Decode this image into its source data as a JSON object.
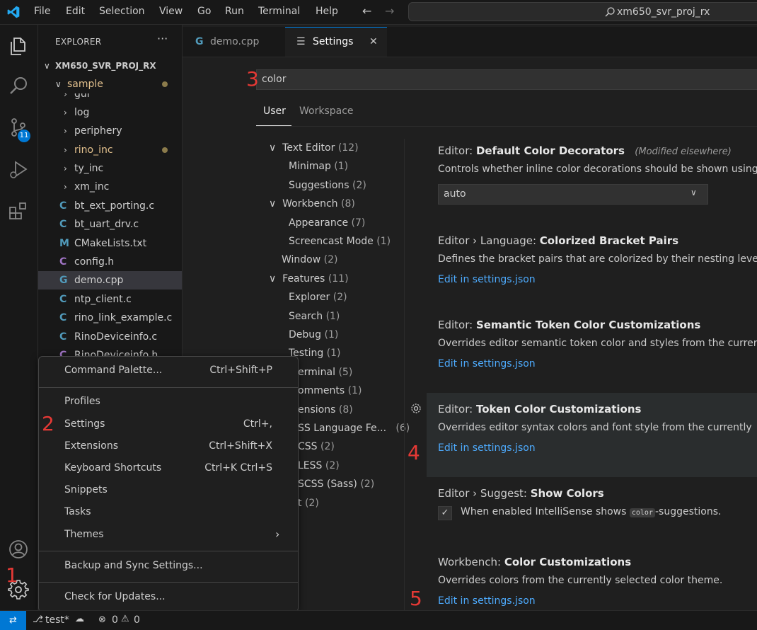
{
  "titlebar": {
    "menus": [
      "File",
      "Edit",
      "Selection",
      "View",
      "Go",
      "Run",
      "Terminal",
      "Help"
    ],
    "search_text": "xm650_svr_proj_rx"
  },
  "activity": {
    "source_control_badge": "11"
  },
  "explorer": {
    "header": "EXPLORER",
    "project": "XM650_SVR_PROJ_RX",
    "folder": "sample",
    "items": [
      {
        "label": "gui",
        "type": "folder"
      },
      {
        "label": "log",
        "type": "folder"
      },
      {
        "label": "periphery",
        "type": "folder"
      },
      {
        "label": "rino_inc",
        "type": "folder"
      },
      {
        "label": "ty_inc",
        "type": "folder"
      },
      {
        "label": "xm_inc",
        "type": "folder"
      },
      {
        "label": "bt_ext_porting.c",
        "type": "c"
      },
      {
        "label": "bt_uart_drv.c",
        "type": "c"
      },
      {
        "label": "CMakeLists.txt",
        "type": "m"
      },
      {
        "label": "config.h",
        "type": "h"
      },
      {
        "label": "demo.cpp",
        "type": "cpp"
      },
      {
        "label": "ntp_client.c",
        "type": "c"
      },
      {
        "label": "rino_link_example.c",
        "type": "c"
      },
      {
        "label": "RinoDeviceinfo.c",
        "type": "c"
      },
      {
        "label": "RinoDeviceinfo.h",
        "type": "h"
      }
    ]
  },
  "tabs": [
    {
      "label": "demo.cpp"
    },
    {
      "label": "Settings"
    }
  ],
  "settings": {
    "search_value": "color",
    "scope_tabs": [
      "User",
      "Workspace"
    ],
    "toc": [
      {
        "label": "Text Editor",
        "count": "(12)"
      },
      {
        "label": "Minimap",
        "count": "(1)"
      },
      {
        "label": "Suggestions",
        "count": "(2)"
      },
      {
        "label": "Workbench",
        "count": "(8)"
      },
      {
        "label": "Appearance",
        "count": "(7)"
      },
      {
        "label": "Screencast Mode",
        "count": "(1)"
      },
      {
        "label": "Window",
        "count": "(2)"
      },
      {
        "label": "Features",
        "count": "(11)"
      },
      {
        "label": "Explorer",
        "count": "(2)"
      },
      {
        "label": "Search",
        "count": "(1)"
      },
      {
        "label": "Debug",
        "count": "(1)"
      },
      {
        "label": "Testing",
        "count": "(1)"
      },
      {
        "label": "erminal",
        "count": "(5)"
      },
      {
        "label": "omments",
        "count": "(1)"
      },
      {
        "label": "ensions",
        "count": "(8)"
      },
      {
        "label": "SS Language Fe...",
        "count": "(6)"
      },
      {
        "label": "CSS",
        "count": "(2)"
      },
      {
        "label": "LESS",
        "count": "(2)"
      },
      {
        "label": "SCSS (Sass)",
        "count": "(2)"
      },
      {
        "label": "t",
        "count": "(2)"
      }
    ],
    "items": [
      {
        "cat": "Editor: ",
        "name": "Default Color Decorators",
        "note": "(Modified elsewhere)",
        "desc": "Controls whether inline color decorations should be shown using",
        "select": "auto"
      },
      {
        "cat": "Editor › Language: ",
        "name": "Colorized Bracket Pairs",
        "desc": "Defines the bracket pairs that are colorized by their nesting leve",
        "link": "Edit in settings.json"
      },
      {
        "cat": "Editor: ",
        "name": "Semantic Token Color Customizations",
        "desc": "Overrides editor semantic token color and styles from the currer",
        "link": "Edit in settings.json"
      },
      {
        "cat": "Editor: ",
        "name": "Token Color Customizations",
        "desc": "Overrides editor syntax colors and font style from the currently",
        "link": "Edit in settings.json"
      },
      {
        "cat": "Editor › Suggest: ",
        "name": "Show Colors",
        "desc_pre": "When enabled IntelliSense shows ",
        "desc_code": "color",
        "desc_post": "-suggestions."
      },
      {
        "cat": "Workbench: ",
        "name": "Color Customizations",
        "desc": "Overrides colors from the currently selected color theme.",
        "link": "Edit in settings.json"
      }
    ]
  },
  "manage_menu": {
    "items": [
      {
        "label": "Command Palette...",
        "key": "Ctrl+Shift+P"
      },
      {
        "label": "Profiles",
        "key": ""
      },
      {
        "label": "Settings",
        "key": "Ctrl+,"
      },
      {
        "label": "Extensions",
        "key": "Ctrl+Shift+X"
      },
      {
        "label": "Keyboard Shortcuts",
        "key": "Ctrl+K Ctrl+S"
      },
      {
        "label": "Snippets",
        "key": ""
      },
      {
        "label": "Tasks",
        "key": ""
      },
      {
        "label": "Themes",
        "key": ""
      },
      {
        "label": "Backup and Sync Settings...",
        "key": ""
      },
      {
        "label": "Check for Updates...",
        "key": ""
      }
    ]
  },
  "annotations": [
    "1",
    "2",
    "3",
    "4",
    "5"
  ],
  "statusbar": {
    "branch": "test*",
    "errors": "0",
    "warnings": "0"
  },
  "colors": {
    "accent": "#0078d4",
    "link": "#4daafc",
    "annotation": "#e53935",
    "modified": "#e2c08d"
  }
}
